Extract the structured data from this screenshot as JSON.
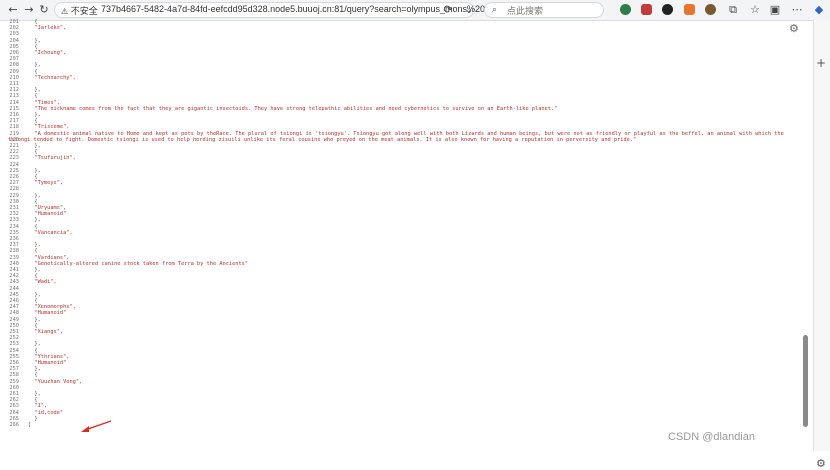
{
  "browser": {
    "security_warning": "不安全",
    "url": "737b4667-5482-4a7d-84fd-eefcdd95d328.node5.buuoj.cn:81/query?search=olympus_mons%20union%20sel...",
    "search_placeholder": "点此搜索"
  },
  "lines": [
    {
      "n": "201",
      "t": "  {"
    },
    {
      "n": "202",
      "t": "  \"Jarleks\",",
      "s": true
    },
    {
      "n": "203",
      "t": ""
    },
    {
      "n": "204",
      "t": "  },"
    },
    {
      "n": "205",
      "t": "  {"
    },
    {
      "n": "206",
      "t": "  \"Ichoung\",",
      "s": true
    },
    {
      "n": "207",
      "t": ""
    },
    {
      "n": "208",
      "t": "  },"
    },
    {
      "n": "209",
      "t": "  {"
    },
    {
      "n": "210",
      "t": "  \"Technarchy\",",
      "s": true
    },
    {
      "n": "211",
      "t": ""
    },
    {
      "n": "212",
      "t": "  },"
    },
    {
      "n": "213",
      "t": "  {"
    },
    {
      "n": "214",
      "t": "  \"Times\",",
      "s": true
    },
    {
      "n": "215",
      "t": "  \"The nickname comes from the fact that they are gigantic insectoids. They have strong telepathic abilities and need cybernetics to survive on an Earth-like planet.\"",
      "s": true
    },
    {
      "n": "216",
      "t": "  },"
    },
    {
      "n": "217",
      "t": "  {"
    },
    {
      "n": "218",
      "t": "  \"Trisceme\",",
      "s": true
    },
    {
      "n": "219",
      "t": "  \"A domestic animal native to Home and kept as pets by theRace. The plural of tsiongi is 'tsiongyu'. Tsiongyu got along well with both Lizards and human beings, but were not as friendly or playful as the beffel, an animal with which the",
      "s": true
    },
    {
      "n": "220",
      "t": "tsiongi tended to fight. Domestic tsiongi is used to help herding zisuili unlike its feral cousins who preyed on the meat animals. It is also known for having a reputation in perversity and pride.\"",
      "s": true,
      "wrap": true
    },
    {
      "n": "221",
      "t": "  },"
    },
    {
      "n": "222",
      "t": "  {"
    },
    {
      "n": "223",
      "t": "  \"Tsufurujin\",",
      "s": true
    },
    {
      "n": "224",
      "t": ""
    },
    {
      "n": "225",
      "t": "  },"
    },
    {
      "n": "226",
      "t": "  {"
    },
    {
      "n": "227",
      "t": "  \"Tymeys\",",
      "s": true
    },
    {
      "n": "228",
      "t": ""
    },
    {
      "n": "229",
      "t": "  },"
    },
    {
      "n": "230",
      "t": "  {"
    },
    {
      "n": "231",
      "t": "  \"Uryuams\",",
      "s": true
    },
    {
      "n": "232",
      "t": "  \"Humanoid\"",
      "s": true
    },
    {
      "n": "233",
      "t": "  },"
    },
    {
      "n": "234",
      "t": "  {"
    },
    {
      "n": "235",
      "t": "  \"Vancancia\",",
      "s": true
    },
    {
      "n": "236",
      "t": ""
    },
    {
      "n": "237",
      "t": "  },"
    },
    {
      "n": "238",
      "t": "  {"
    },
    {
      "n": "239",
      "t": "  \"Vardians\",",
      "s": true
    },
    {
      "n": "240",
      "t": "  \"Genetically-altered canine stock taken from Terra by the Ancients\"",
      "s": true
    },
    {
      "n": "241",
      "t": "  },"
    },
    {
      "n": "242",
      "t": "  {"
    },
    {
      "n": "243",
      "t": "  \"Wadi\",",
      "s": true
    },
    {
      "n": "244",
      "t": ""
    },
    {
      "n": "245",
      "t": "  },"
    },
    {
      "n": "246",
      "t": "  {"
    },
    {
      "n": "247",
      "t": "  \"Xenomorphs\",",
      "s": true
    },
    {
      "n": "248",
      "t": "  \"Humanoid\"",
      "s": true
    },
    {
      "n": "249",
      "t": "  },"
    },
    {
      "n": "250",
      "t": "  {"
    },
    {
      "n": "251",
      "t": "  \"Xiangs\",",
      "s": true
    },
    {
      "n": "252",
      "t": ""
    },
    {
      "n": "253",
      "t": "  },"
    },
    {
      "n": "254",
      "t": "  {"
    },
    {
      "n": "255",
      "t": "  \"Ythrians\",",
      "s": true
    },
    {
      "n": "256",
      "t": "  \"Humanoid\"",
      "s": true
    },
    {
      "n": "257",
      "t": "  },"
    },
    {
      "n": "258",
      "t": "  {"
    },
    {
      "n": "259",
      "t": "  \"Yuuzhan Vong\",",
      "s": true
    },
    {
      "n": "260",
      "t": ""
    },
    {
      "n": "261",
      "t": "  },"
    },
    {
      "n": "262",
      "t": "  {"
    },
    {
      "n": "263",
      "t": "  \"1\",",
      "s": true
    },
    {
      "n": "264",
      "t": "  \"id,code\"",
      "s": true
    },
    {
      "n": "265",
      "t": "  }"
    },
    {
      "n": "266",
      "t": "]"
    }
  ],
  "watermark": "CSDN @dlandian",
  "colors": {
    "string": "#b5302d",
    "line_number": "#777777",
    "annotation_arrow": "#e02a1f"
  }
}
